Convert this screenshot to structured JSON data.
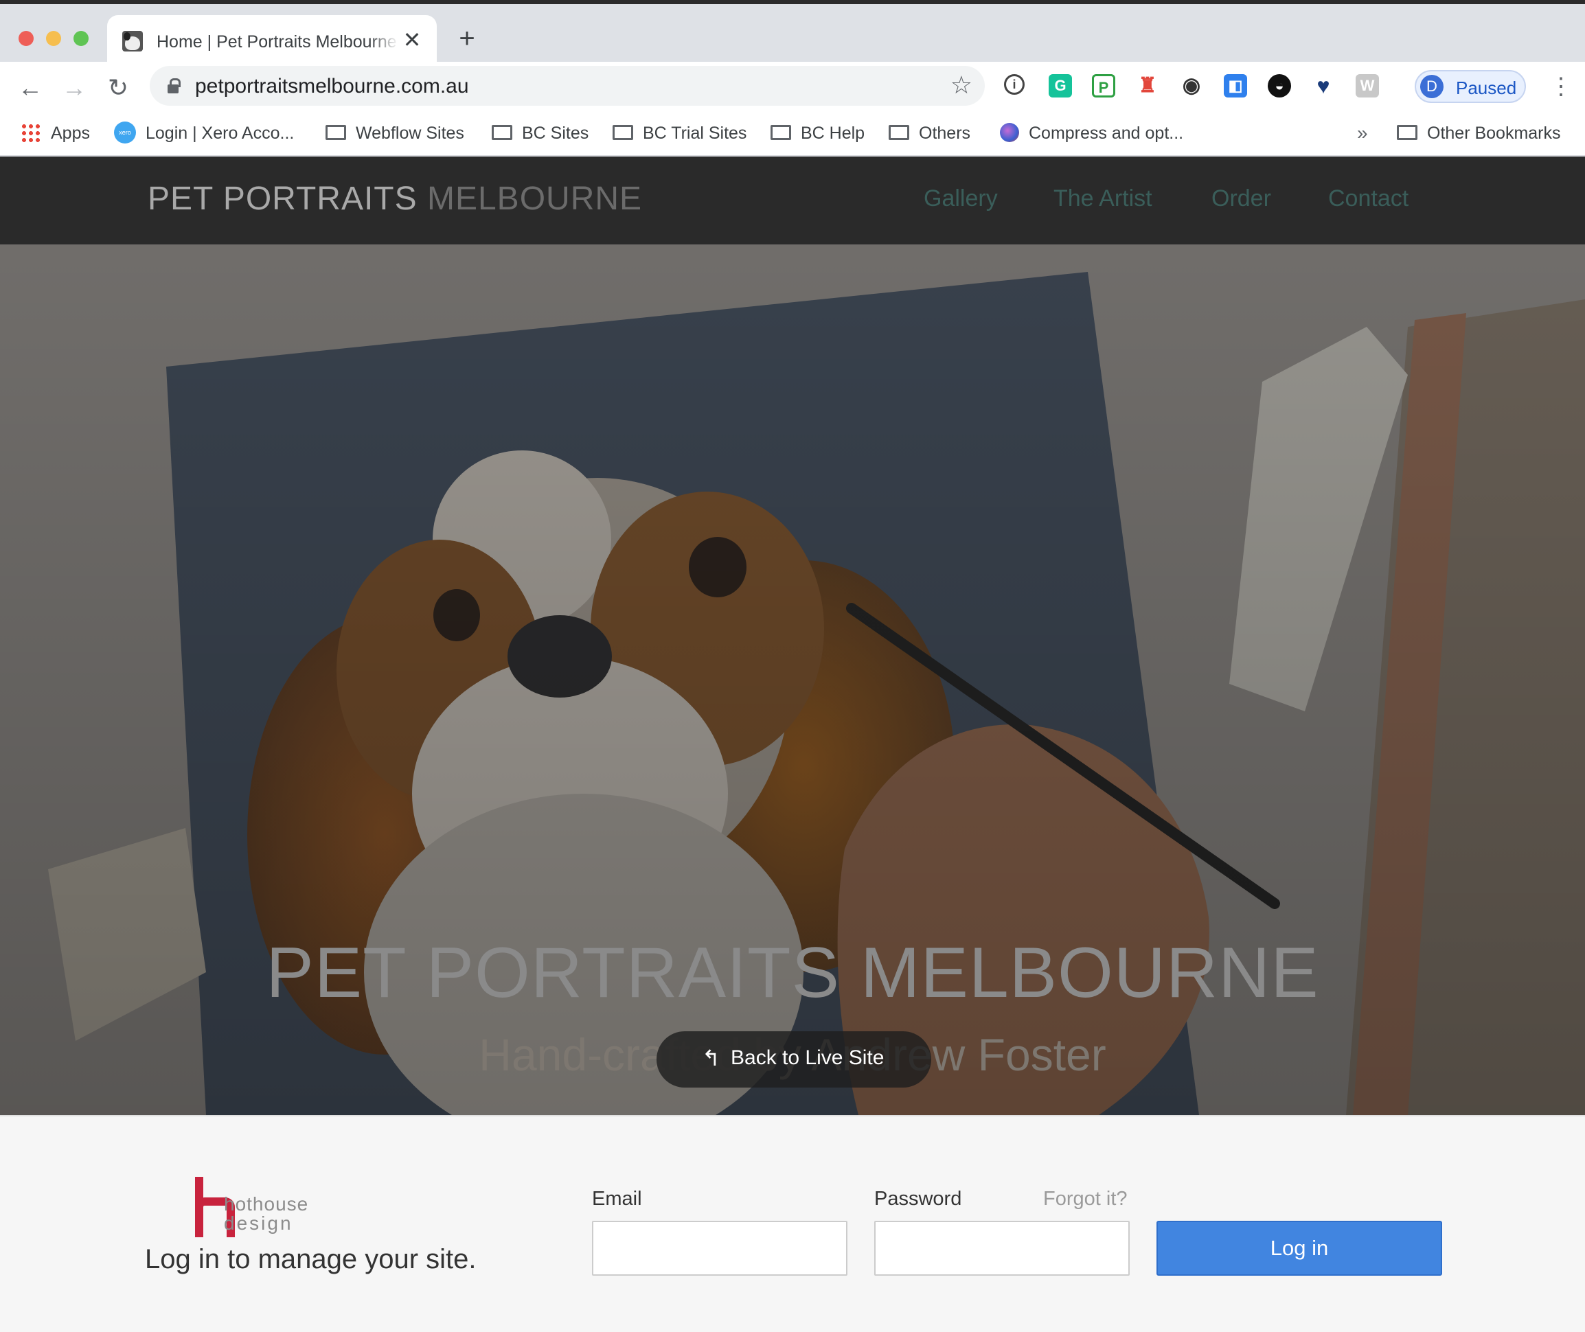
{
  "browser": {
    "tab_title": "Home | Pet Portraits Melbourne",
    "tab_close": "✕",
    "new_tab": "+",
    "url": "petportraitsmelbourne.com.au",
    "profile_initial": "D",
    "profile_status": "Paused",
    "extensions": [
      "password-manager",
      "grammarly",
      "paragraph",
      "lighthouse",
      "visibility",
      "tag",
      "eye-mask",
      "heart",
      "w"
    ],
    "bookmarks": [
      {
        "label": "Apps",
        "icon": "apps-grid-icon"
      },
      {
        "label": "Login | Xero Acco...",
        "icon": "xero-icon"
      },
      {
        "label": "Webflow Sites",
        "icon": "folder-icon"
      },
      {
        "label": "BC Sites",
        "icon": "folder-icon"
      },
      {
        "label": "BC Trial Sites",
        "icon": "folder-icon"
      },
      {
        "label": "BC Help",
        "icon": "folder-icon"
      },
      {
        "label": "Others",
        "icon": "folder-icon"
      },
      {
        "label": "Compress and opt...",
        "icon": "compress-icon"
      }
    ],
    "overflow": "»",
    "other_bookmarks": "Other Bookmarks"
  },
  "site": {
    "brand_main": "PET PORTRAITS",
    "brand_dim": "MELBOURNE",
    "nav": [
      "Gallery",
      "The Artist",
      "Order",
      "Contact"
    ],
    "nav_color": "#3a5e5a",
    "hero_title": "PET PORTRAITS MELBOURNE",
    "hero_subtitle": "Hand-crafted by Andrew Foster",
    "back_to_live": "Back to Live Site"
  },
  "login": {
    "logo_line1": "hothouse",
    "logo_line2": "design",
    "tagline": "Log in to manage your site.",
    "email_label": "Email",
    "password_label": "Password",
    "forgot": "Forgot it?",
    "button": "Log in",
    "button_color": "#4185e0"
  }
}
